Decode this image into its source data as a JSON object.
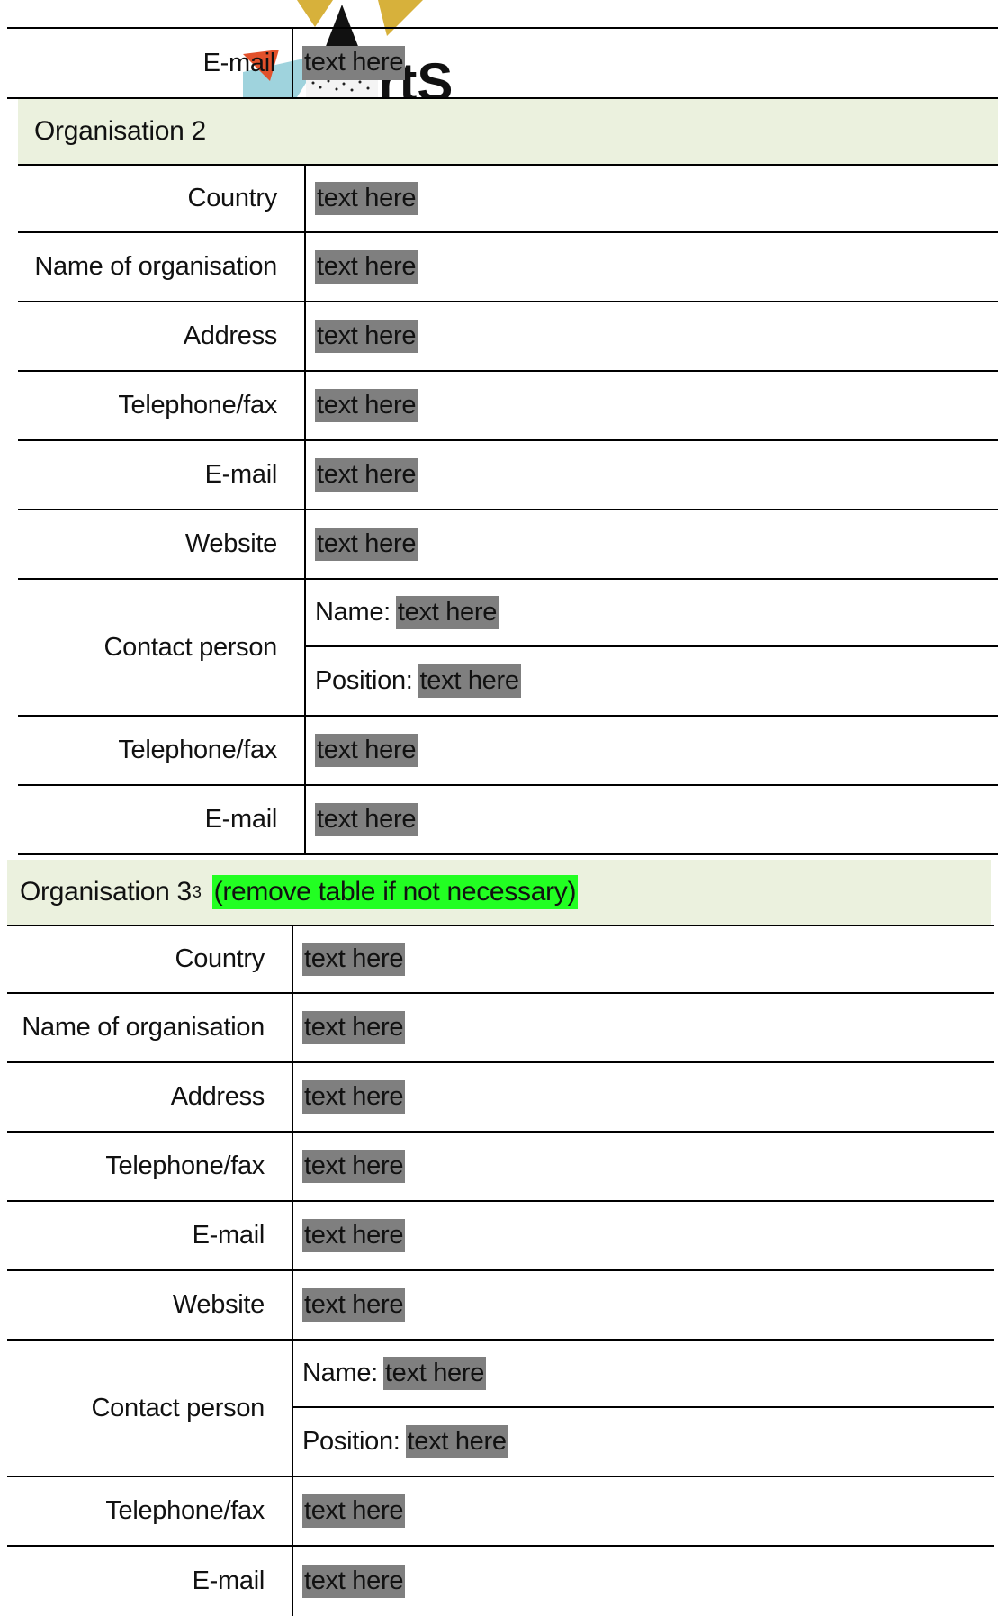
{
  "placeholder": "text here",
  "top_row": {
    "label": "E-mail",
    "value": "text here"
  },
  "org2": {
    "title": "Organisation 2",
    "rows": [
      {
        "label": "Country",
        "value": "text here"
      },
      {
        "label": "Name of organisation",
        "value": "text here"
      },
      {
        "label": "Address",
        "value": "text here"
      },
      {
        "label": "Telephone/fax",
        "value": "text here"
      },
      {
        "label": "E-mail",
        "value": "text here"
      },
      {
        "label": "Website",
        "value": "text here"
      }
    ],
    "contact": {
      "label": "Contact person",
      "name_label": "Name:",
      "name_value": "text here",
      "position_label": "Position:",
      "position_value": "text here"
    },
    "rows_after": [
      {
        "label": "Telephone/fax",
        "value": "text here"
      },
      {
        "label": "E-mail",
        "value": "text here"
      }
    ]
  },
  "org3": {
    "title": "Organisation 3",
    "footnote_mark": "3",
    "note": "(remove table if not necessary)",
    "rows": [
      {
        "label": "Country",
        "value": "text here"
      },
      {
        "label": "Name of organisation",
        "value": "text here"
      },
      {
        "label": "Address",
        "value": "text here"
      },
      {
        "label": "Telephone/fax",
        "value": "text here"
      },
      {
        "label": "E-mail",
        "value": "text here"
      },
      {
        "label": "Website",
        "value": "text here"
      }
    ],
    "contact": {
      "label": "Contact person",
      "name_label": "Name:",
      "name_value": "text here",
      "position_label": "Position:",
      "position_value": "text here"
    },
    "rows_after": [
      {
        "label": "Telephone/fax",
        "value": "text here"
      },
      {
        "label": "E-mail",
        "value": "text here"
      }
    ]
  },
  "colors": {
    "section_header_bg": "#ebf1de",
    "placeholder_bg": "#7f7f7f",
    "note_highlight": "#22ff22"
  }
}
